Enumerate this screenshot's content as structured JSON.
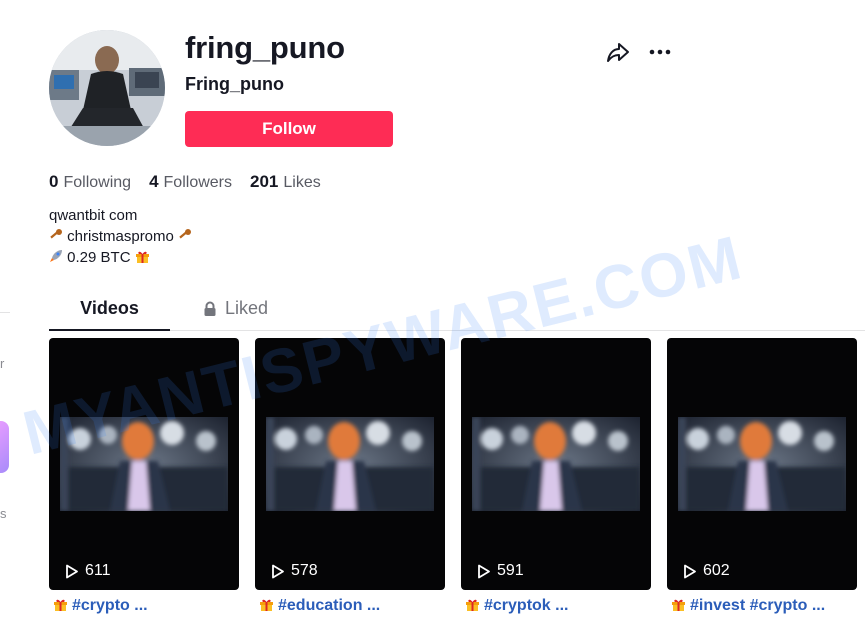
{
  "profile": {
    "username": "fring_puno",
    "nickname": "Fring_puno",
    "follow_label": "Follow"
  },
  "stats": [
    {
      "count": "0",
      "label": "Following"
    },
    {
      "count": "4",
      "label": "Followers"
    },
    {
      "count": "201",
      "label": "Likes"
    }
  ],
  "bio": {
    "line1": "qwantbit com",
    "line2": "christmaspromo",
    "line3": "0.29 BTC"
  },
  "tabs": [
    {
      "label": "Videos",
      "active": true
    },
    {
      "label": "Liked",
      "active": false
    }
  ],
  "videos": [
    {
      "views": "611",
      "caption": "#crypto ..."
    },
    {
      "views": "578",
      "caption": "#education ..."
    },
    {
      "views": "591",
      "caption": "#cryptok ..."
    },
    {
      "views": "602",
      "caption": "#invest #crypto ..."
    }
  ],
  "colors": {
    "brand": "#fe2c55",
    "hashtag": "#2b5db9"
  },
  "icons": [
    "share-icon",
    "more-icon",
    "lock-icon",
    "play-icon",
    "key-icon",
    "rocket-icon",
    "gift-icon"
  ],
  "watermark": "MYANTISPYWARE.COM",
  "sidebar": {
    "char1": "r",
    "char2": "s"
  }
}
